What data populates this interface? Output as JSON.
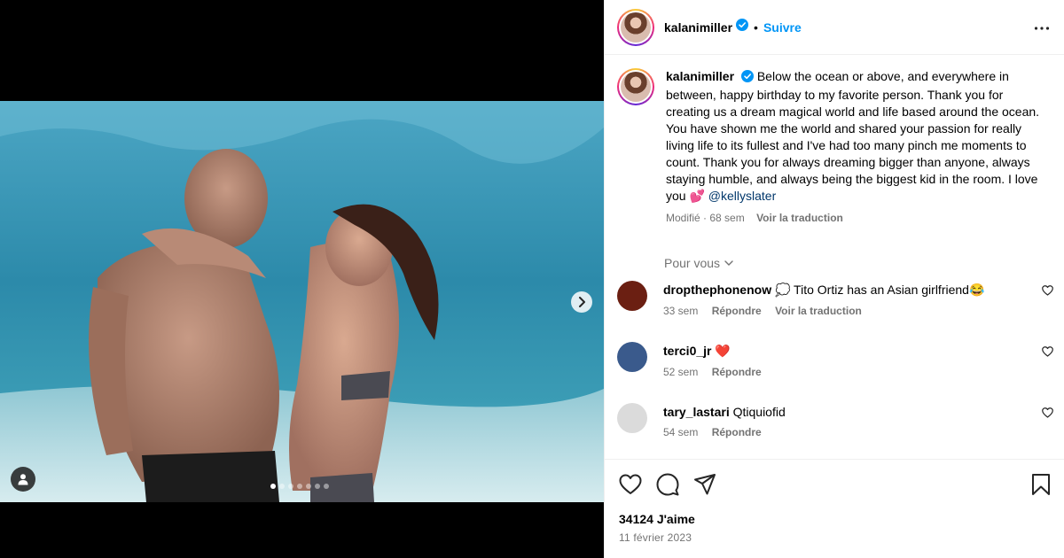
{
  "post": {
    "username": "kalanimiller",
    "follow_label": "Suivre",
    "separator": "•",
    "caption": "Below the ocean or above, and everywhere in between, happy birthday to my favorite person. Thank you for creating us a dream magical world and life based around the ocean. You have shown me the world and shared your passion for really living life to its fullest and I've had too many pinch me moments to count. Thank you for always dreaming bigger than anyone, always staying humble, and always being the biggest kid in the room. I love you 💕",
    "mention": "@kellyslater",
    "edited_label": "Modifié",
    "edited_time": "68 sem",
    "translate_label": "Voir la traduction",
    "pour_vous_label": "Pour vous",
    "likes_label": "34124 J'aime",
    "date_label": "11 février 2023",
    "carousel_count": 7,
    "carousel_active": 1
  },
  "comments": [
    {
      "username": "dropthephonenow",
      "text": "💭 Tito Ortiz has an Asian girlfriend😂",
      "time": "33 sem",
      "reply_label": "Répondre",
      "translate_label": "Voir la traduction",
      "avatar_color": "#6b1f12"
    },
    {
      "username": "terci0_jr",
      "text": "❤️",
      "time": "52 sem",
      "reply_label": "Répondre",
      "avatar_color": "#3a5a8c"
    },
    {
      "username": "tary_lastari",
      "text": "Qtiquiofid",
      "time": "54 sem",
      "reply_label": "Répondre",
      "avatar_color": "#dbdbdb"
    }
  ],
  "colors": {
    "accent": "#0095f6",
    "verified": "#0095f6",
    "secondary_text": "#737373",
    "mention": "#00376b"
  },
  "icons": [
    "verified-icon",
    "more-options-icon",
    "chevron-right-icon",
    "user-tag-icon",
    "chevron-down-icon",
    "heart-icon",
    "comment-icon",
    "share-icon",
    "bookmark-icon"
  ]
}
